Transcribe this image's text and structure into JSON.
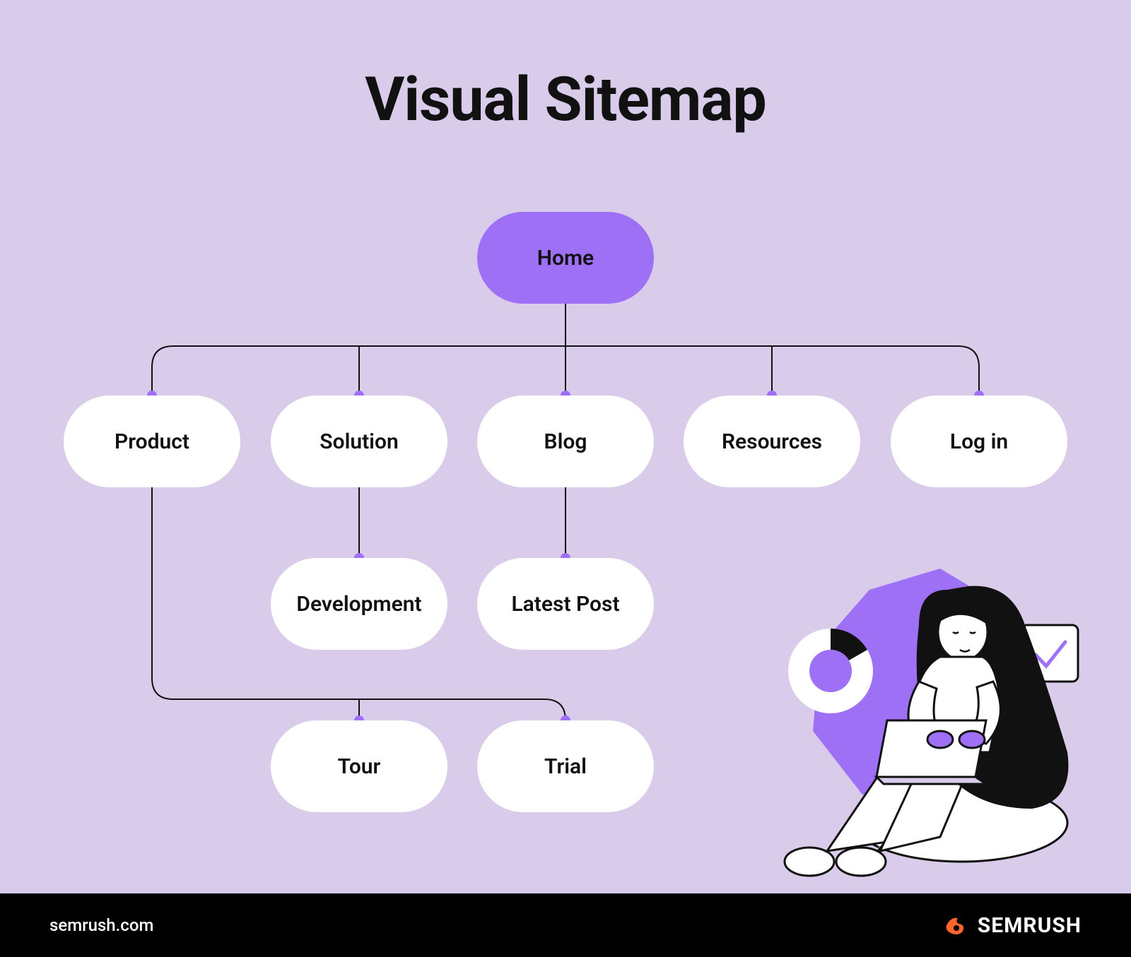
{
  "title": "Visual Sitemap",
  "colors": {
    "background": "#d9cbea",
    "accent": "#9e70f6",
    "node": "#ffffff",
    "text": "#111111",
    "footer": "#000000",
    "brand_orange": "#ff642d"
  },
  "sitemap": {
    "root": {
      "label": "Home"
    },
    "level1": [
      {
        "label": "Product"
      },
      {
        "label": "Solution"
      },
      {
        "label": "Blog"
      },
      {
        "label": "Resources"
      },
      {
        "label": "Log in"
      }
    ],
    "level2": [
      {
        "parent": "Solution",
        "label": "Development"
      },
      {
        "parent": "Blog",
        "label": "Latest Post"
      }
    ],
    "level3": [
      {
        "parent": "Product",
        "label": "Tour"
      },
      {
        "parent": "Product",
        "label": "Trial"
      }
    ]
  },
  "footer": {
    "url": "semrush.com",
    "brand": "SEMRUSH"
  }
}
